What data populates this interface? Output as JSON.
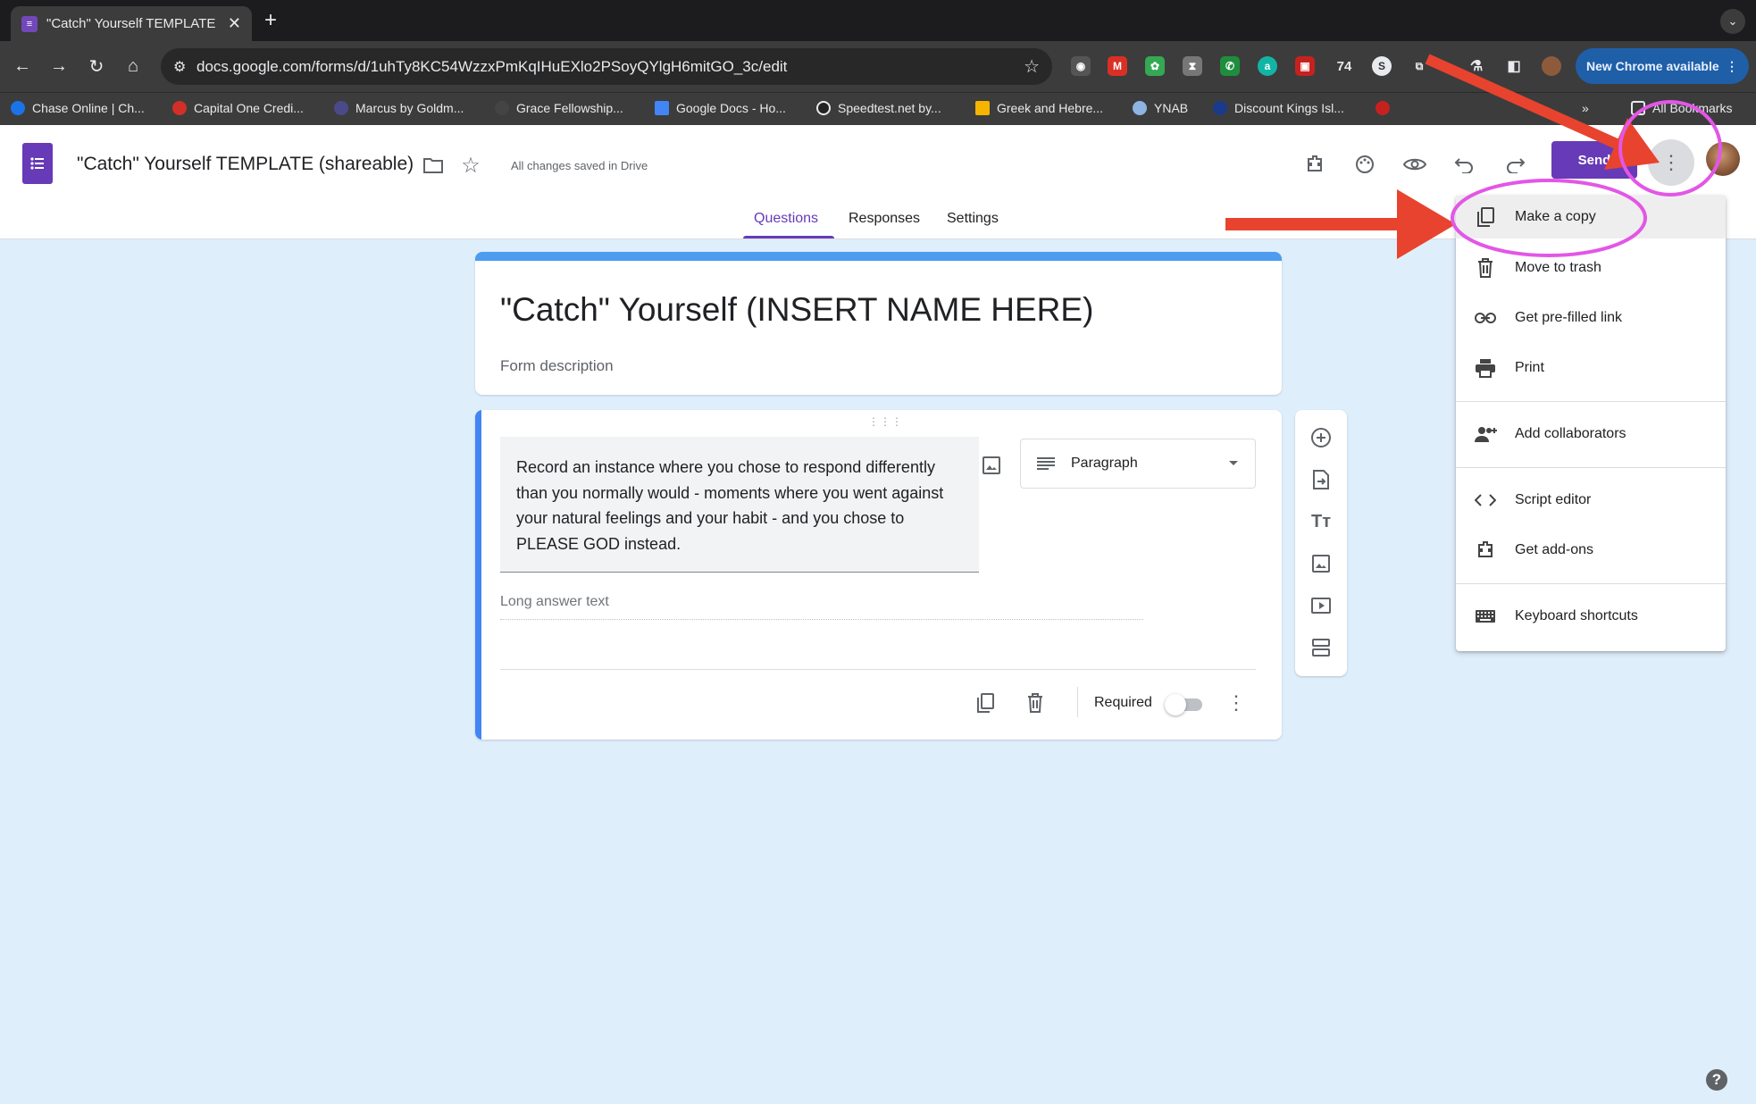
{
  "browser": {
    "tab_title": "\"Catch\" Yourself TEMPLATE",
    "url": "docs.google.com/forms/d/1uhTy8KC54WzzxPmKqIHuEXlo2PSoyQYlgH6mitGO_3c/edit",
    "extension_badge": "74",
    "update_label": "New Chrome available",
    "bookmarks": [
      {
        "label": "Chase Online | Ch...",
        "color": "#1a73e8"
      },
      {
        "label": "Capital One Credi...",
        "color": "#d03027"
      },
      {
        "label": "Marcus by Goldm...",
        "color": "#4a4a8a"
      },
      {
        "label": "Grace Fellowship...",
        "color": "#444444"
      },
      {
        "label": "Google Docs - Ho...",
        "color": "#4285f4"
      },
      {
        "label": "Speedtest.net by...",
        "color": "#222222"
      },
      {
        "label": "Greek and Hebre...",
        "color": "#f4b400"
      },
      {
        "label": "YNAB",
        "color": "#8eb4e3"
      },
      {
        "label": "Discount Kings Isl...",
        "color": "#1b3a8c"
      }
    ],
    "all_bookmarks": "All Bookmarks"
  },
  "header": {
    "doc_title": "\"Catch\" Yourself TEMPLATE (shareable)",
    "saved_status": "All changes saved in Drive",
    "send_label": "Send"
  },
  "form_tabs": [
    "Questions",
    "Responses",
    "Settings"
  ],
  "form": {
    "title": "\"Catch\" Yourself (INSERT NAME HERE)",
    "description_placeholder": "Form description"
  },
  "question": {
    "text": "Record an instance where you chose to respond differently than you normally would - moments where you went against your natural feelings and your habit - and you chose to PLEASE GOD instead.",
    "type": "Paragraph",
    "answer_placeholder": "Long answer text",
    "required_label": "Required",
    "required": false
  },
  "menu": {
    "items": [
      {
        "label": "Make a copy",
        "icon": "copy-icon"
      },
      {
        "label": "Move to trash",
        "icon": "trash-icon"
      },
      {
        "label": "Get pre-filled link",
        "icon": "link-icon"
      },
      {
        "label": "Print",
        "icon": "print-icon"
      },
      {
        "label": "Add collaborators",
        "icon": "add-person-icon"
      },
      {
        "label": "Script editor",
        "icon": "code-icon"
      },
      {
        "label": "Get add-ons",
        "icon": "puzzle-icon"
      },
      {
        "label": "Keyboard shortcuts",
        "icon": "keyboard-icon"
      }
    ]
  },
  "colors": {
    "accent": "#673ab7",
    "annotation_arrow": "#e8432e",
    "annotation_circle": "#e356e6"
  }
}
